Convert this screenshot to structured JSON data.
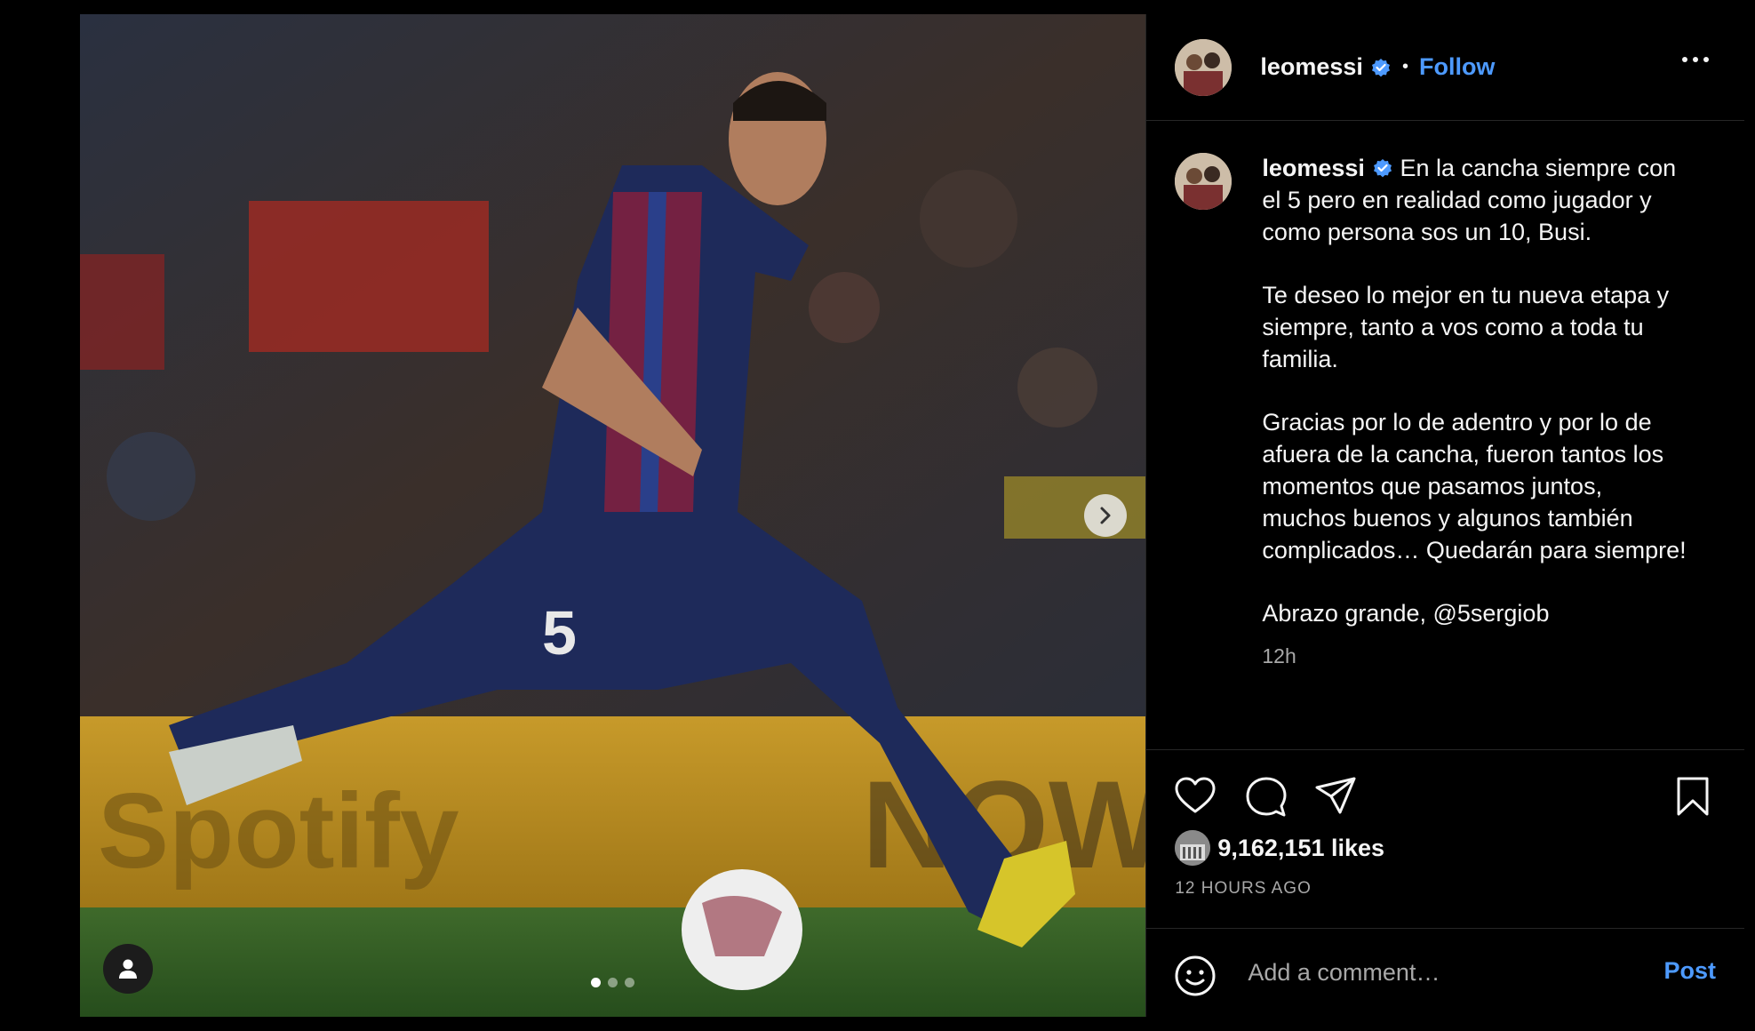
{
  "header": {
    "username": "leomessi",
    "separator": "•",
    "follow_label": "Follow"
  },
  "caption": {
    "username": "leomessi",
    "text": " En la cancha siempre con el 5 pero en realidad como jugador y como persona sos un 10, Busi.\n\nTe deseo lo mejor en tu nueva etapa y siempre, tanto a vos como a toda tu familia.\n\nGracias por lo de adentro y por lo de afuera de la cancha, fueron tantos los momentos que pasamos juntos, muchos buenos y algunos también complicados… Quedarán para siempre!\n\nAbrazo grande, @5sergiob",
    "time": "12h"
  },
  "stats": {
    "likes": "9,162,151 likes",
    "posted_ago": "12 HOURS AGO"
  },
  "comment": {
    "placeholder": "Add a comment…",
    "post_label": "Post"
  },
  "carousel": {
    "total": 3,
    "current": 1
  },
  "colors": {
    "accent": "#4d9aff",
    "background": "#000000",
    "secondary_text": "#a8a8a8",
    "verified": "#4d9aff"
  },
  "icons": [
    "tag-user-icon",
    "chevron-right-icon",
    "verified-badge-icon",
    "more-icon",
    "heart-icon",
    "comment-icon",
    "share-icon",
    "bookmark-icon",
    "emoji-icon"
  ]
}
